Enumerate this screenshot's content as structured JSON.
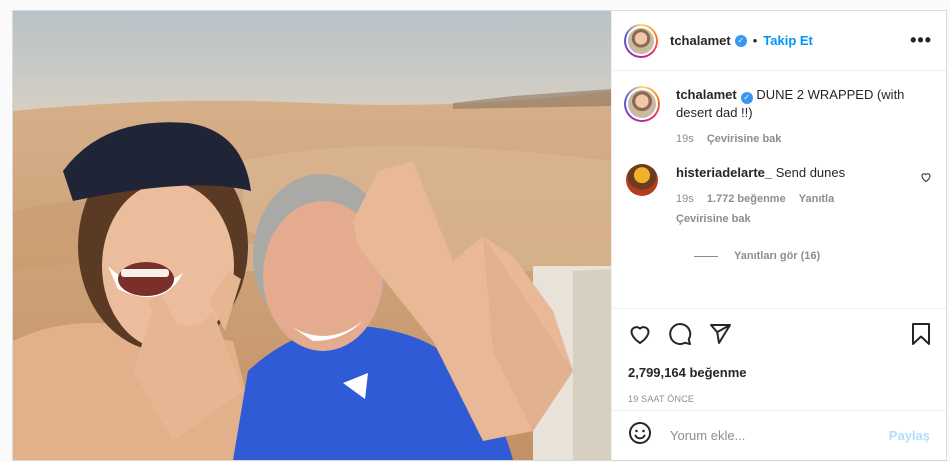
{
  "post": {
    "username": "tchalamet",
    "verified_mark": "✓",
    "follow_label": "Takip Et",
    "more_label": "•••",
    "caption": "DUNE 2 WRAPPED (with desert dad !!)",
    "caption_age": "19s",
    "translate_label": "Çevirisine bak",
    "likes": "2,799,164 beğenme",
    "posted_ago": "19 SAAT ÖNCE"
  },
  "comments": [
    {
      "username": "histeriadelarte_",
      "text": "Send dunes",
      "age": "19s",
      "likes": "1.772 beğenme",
      "reply_label": "Yanıtla",
      "translate_label": "Çevirisine bak",
      "view_replies": "Yanıtları gör (16)"
    }
  ],
  "comment_input": {
    "placeholder": "Yorum ekle...",
    "share_label": "Paylaş"
  },
  "icons": {
    "like": "heart-icon",
    "comment": "comment-bubble-icon",
    "share": "paper-plane-icon",
    "save": "bookmark-icon",
    "emoji": "smiley-icon",
    "comment_like": "small-heart-icon"
  },
  "colors": {
    "accent": "#0095f6",
    "share_disabled": "#b2dffc",
    "verified": "#3897f0"
  }
}
